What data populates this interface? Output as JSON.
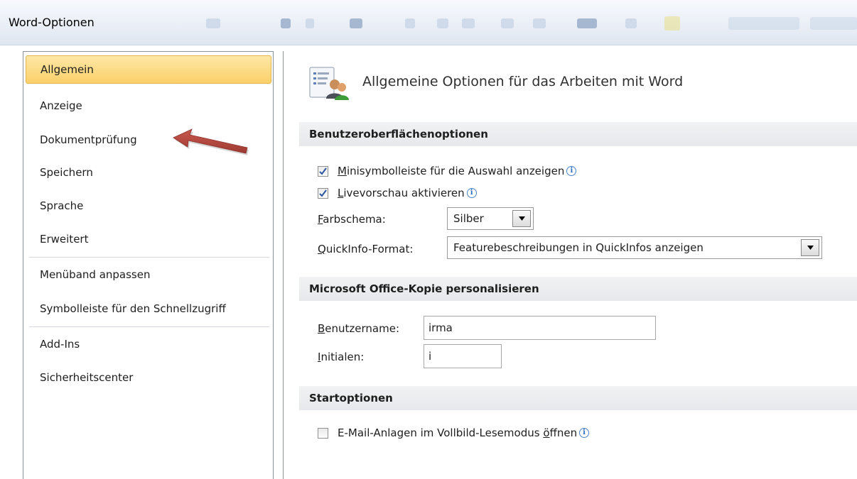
{
  "window": {
    "title": "Word-Optionen"
  },
  "sidebar": {
    "items": [
      {
        "label": "Allgemein",
        "active": true
      },
      {
        "label": "Anzeige"
      },
      {
        "label": "Dokumentprüfung"
      },
      {
        "label": "Speichern"
      },
      {
        "label": "Sprache"
      },
      {
        "label": "Erweitert"
      },
      {
        "label": "Menüband anpassen"
      },
      {
        "label": "Symbolleiste für den Schnellzugriff"
      },
      {
        "label": "Add-Ins"
      },
      {
        "label": "Sicherheitscenter"
      }
    ]
  },
  "content": {
    "header": {
      "title": "Allgemeine Optionen für das Arbeiten mit Word",
      "icon": "general-options-icon"
    },
    "ui_options": {
      "heading": "Benutzeroberflächenoptionen",
      "mini_toolbar": {
        "label_key": "M",
        "label_rest": "inisymbolleiste für die Auswahl anzeigen",
        "checked": true
      },
      "live_preview": {
        "label_key": "L",
        "label_rest": "ivevorschau aktivieren",
        "checked": true
      },
      "color_scheme": {
        "label_key": "F",
        "label_rest": "arbschema:",
        "value": "Silber"
      },
      "tooltip_format": {
        "label_key": "Q",
        "label_rest": "uickInfo-Format:",
        "value": "Featurebeschreibungen in QuickInfos anzeigen"
      }
    },
    "personalize": {
      "heading": "Microsoft Office-Kopie personalisieren",
      "username": {
        "label_key": "B",
        "label_rest": "enutzername:",
        "value": "irma"
      },
      "initials": {
        "label_key": "I",
        "label_rest": "nitialen:",
        "value": "i"
      }
    },
    "startup": {
      "heading": "Startoptionen",
      "full_screen_reading": {
        "label_pre": "E-Mail-Anlagen im Vollbild-Lesemodus ",
        "label_key": "ö",
        "label_rest": "ffnen",
        "checked": false
      }
    }
  },
  "colors": {
    "accent_active": "#fbd06a",
    "annotation_arrow": "#b5423a",
    "info_icon": "#2f6fc0"
  }
}
